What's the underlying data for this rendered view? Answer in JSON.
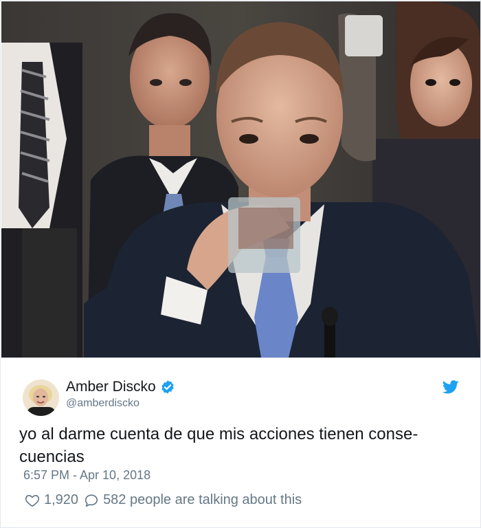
{
  "photo": {
    "alt_subject": "hearing-photo"
  },
  "tweet": {
    "display_name": "Amber Discko",
    "handle": "@amberdiscko",
    "text": "yo al darme cuenta de que mis acciones tienen conse-cuencias",
    "timestamp": "6:57 PM - Apr 10, 2018",
    "likes": "1,920",
    "conversation": "582 people are talking about this",
    "verified": true
  },
  "colors": {
    "twitter_blue": "#1da1f2",
    "secondary_text": "#657786",
    "border": "#e1e8ed"
  },
  "icons": [
    "verified-badge-icon",
    "twitter-bird-icon",
    "heart-icon",
    "comment-bubble-icon"
  ]
}
